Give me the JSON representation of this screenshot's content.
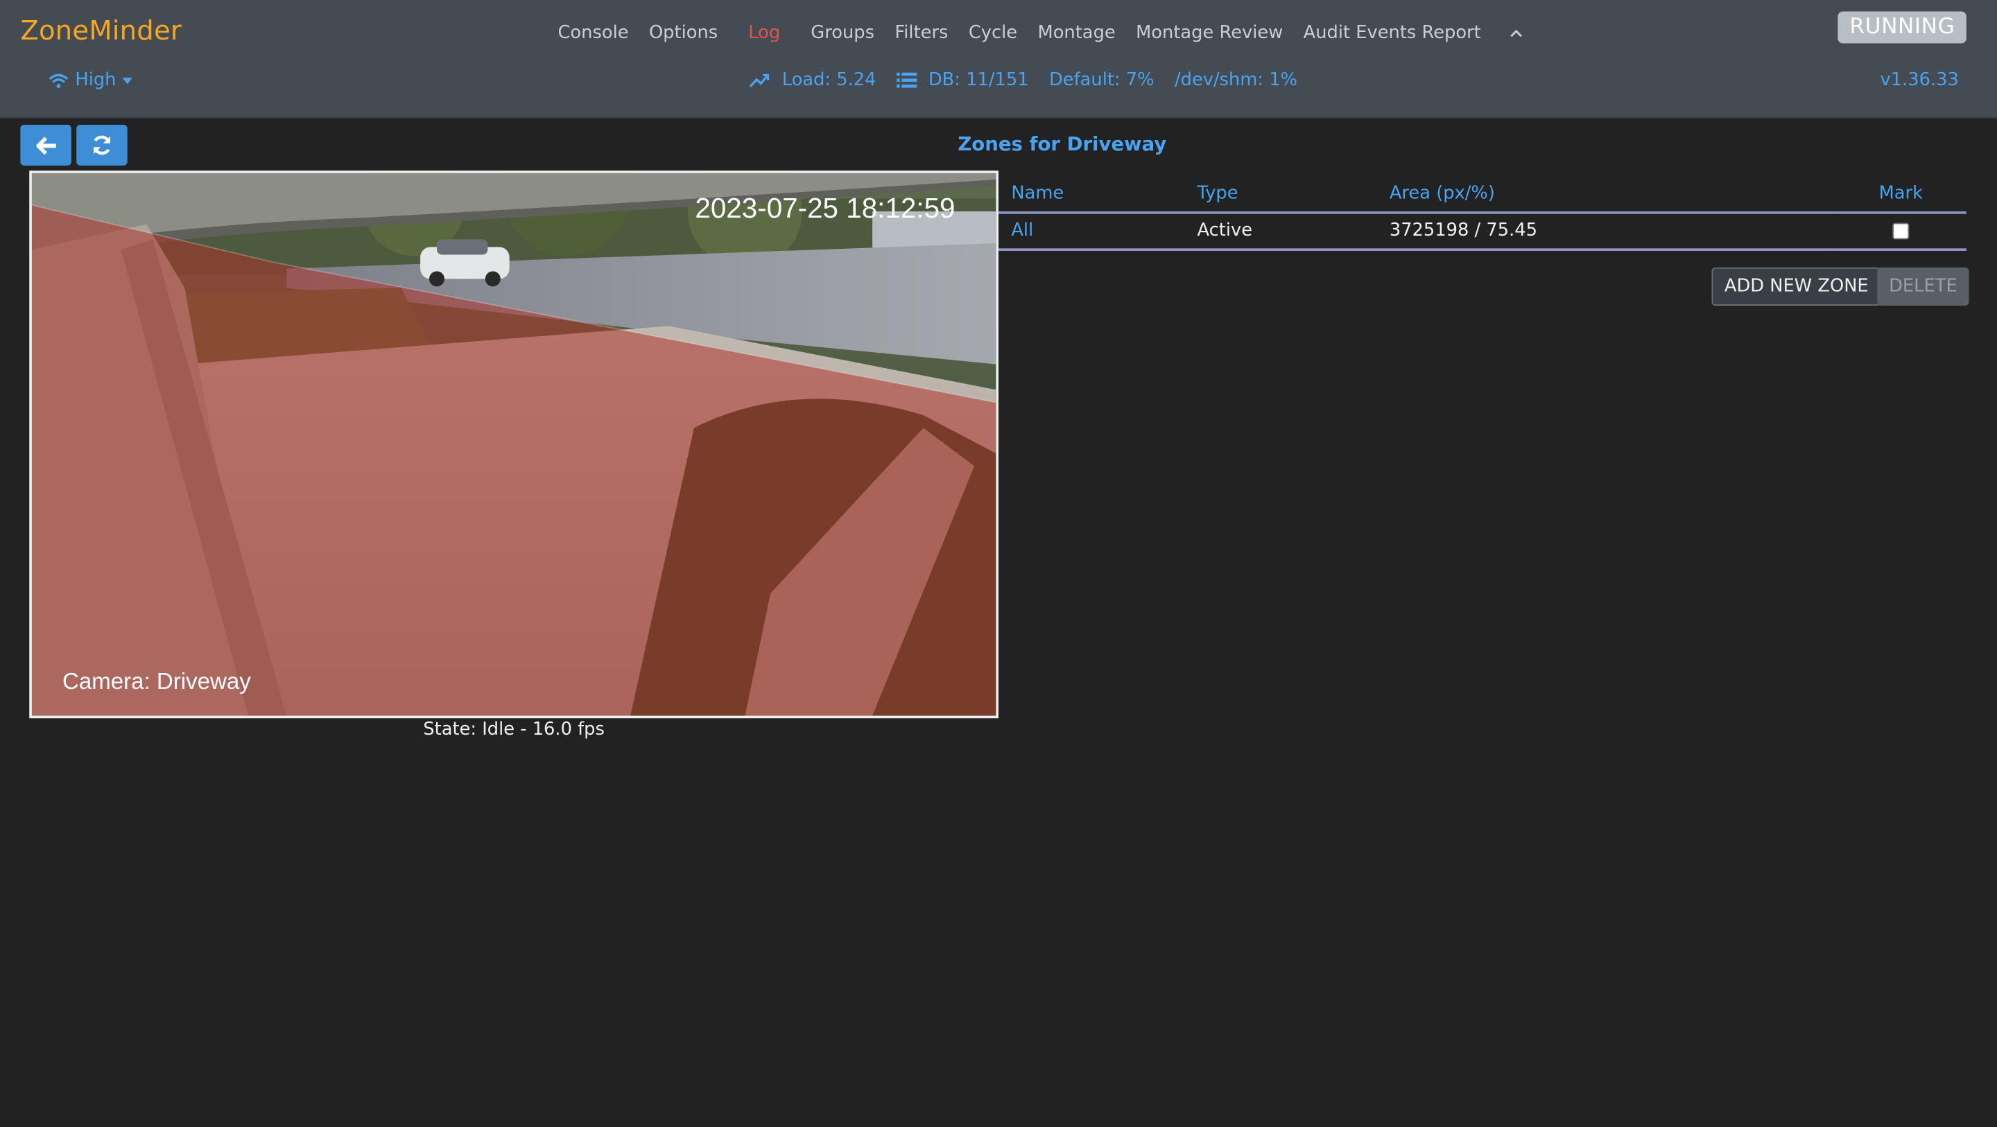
{
  "header": {
    "brand": "ZoneMinder",
    "menu": [
      {
        "label": "Console"
      },
      {
        "label": "Options"
      },
      {
        "label": "Log"
      },
      {
        "label": "Groups"
      },
      {
        "label": "Filters"
      },
      {
        "label": "Cycle"
      },
      {
        "label": "Montage"
      },
      {
        "label": "Montage Review"
      },
      {
        "label": "Audit Events Report"
      }
    ],
    "menu_toggle_icon": "chevron-up-icon",
    "run_state": "RUNNING",
    "bandwidth": "High",
    "bandwidth_icon": "wifi-icon",
    "load": "Load: 5.24",
    "load_icon": "trending-up-icon",
    "db": "DB: 11/151",
    "db_icon": "list-icon",
    "storage_default": "Default: 7%",
    "storage_shm": "/dev/shm: 1%",
    "version": "v1.36.33"
  },
  "toolbar": {
    "back_icon": "arrow-left-icon",
    "refresh_icon": "refresh-icon"
  },
  "page_title": "Zones for Driveway",
  "monitor": {
    "timestamp": "2023-07-25 18:12:59",
    "camera_label": "Camera: Driveway",
    "state": "State: Idle - 16.0 fps",
    "zone_color": "#b03028"
  },
  "zones_table": {
    "columns": [
      "Name",
      "Type",
      "Area (px/%)",
      "Mark"
    ],
    "rows": [
      {
        "name": "All",
        "type": "Active",
        "area": "3725198 / 75.45",
        "marked": false
      }
    ]
  },
  "actions": {
    "add": "ADD NEW ZONE",
    "delete": "DELETE"
  },
  "colors": {
    "navbar_bg": "#444b52",
    "page_bg": "#222222",
    "brand": "#f5a623",
    "link": "#4aa3f0",
    "log": "#e05252",
    "running_badge": "#b6bec6",
    "button": "#3d8ed6",
    "table_rule": "#8d94c8"
  }
}
